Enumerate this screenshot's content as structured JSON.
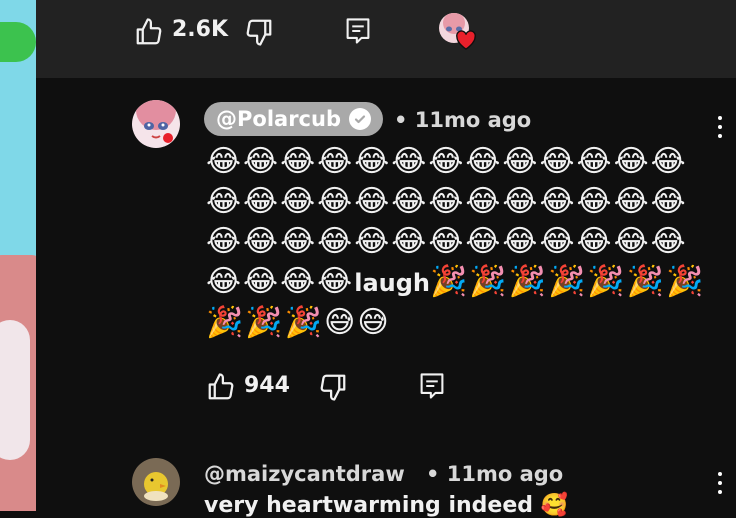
{
  "video_actions": {
    "like_count": "2.6K"
  },
  "comments": [
    {
      "author": "@Polarcub",
      "verified": true,
      "time": "• 11mo ago",
      "body": "😂😂😂😂😂😂😂😂😂😂😂😂😂😂😂😂😂😂😂😂😂😂😂😂😂😂😂😂😂😂😂😂😂😂😂😂😂😂😂😂😂😂😂",
      "body_word": "laugh",
      "body_tail": "🎉🎉🎉🎉🎉🎉🎉🎉🎉🎉😅😅",
      "like_count": "944"
    },
    {
      "author": "@maizycantdraw",
      "time": "• 11mo ago",
      "body": "very heartwarming indeed 🥰"
    }
  ],
  "icons": {
    "like": "thumb-up-icon",
    "dislike": "thumb-down-icon",
    "reply": "comment-icon",
    "more": "kebab-menu-icon",
    "verified": "verified-check-icon",
    "heart": "heart-icon"
  },
  "colors": {
    "background": "#0f0f0f",
    "action_bar": "#222222",
    "author_chip": "#a9a9a9",
    "heart": "#e8202b"
  }
}
